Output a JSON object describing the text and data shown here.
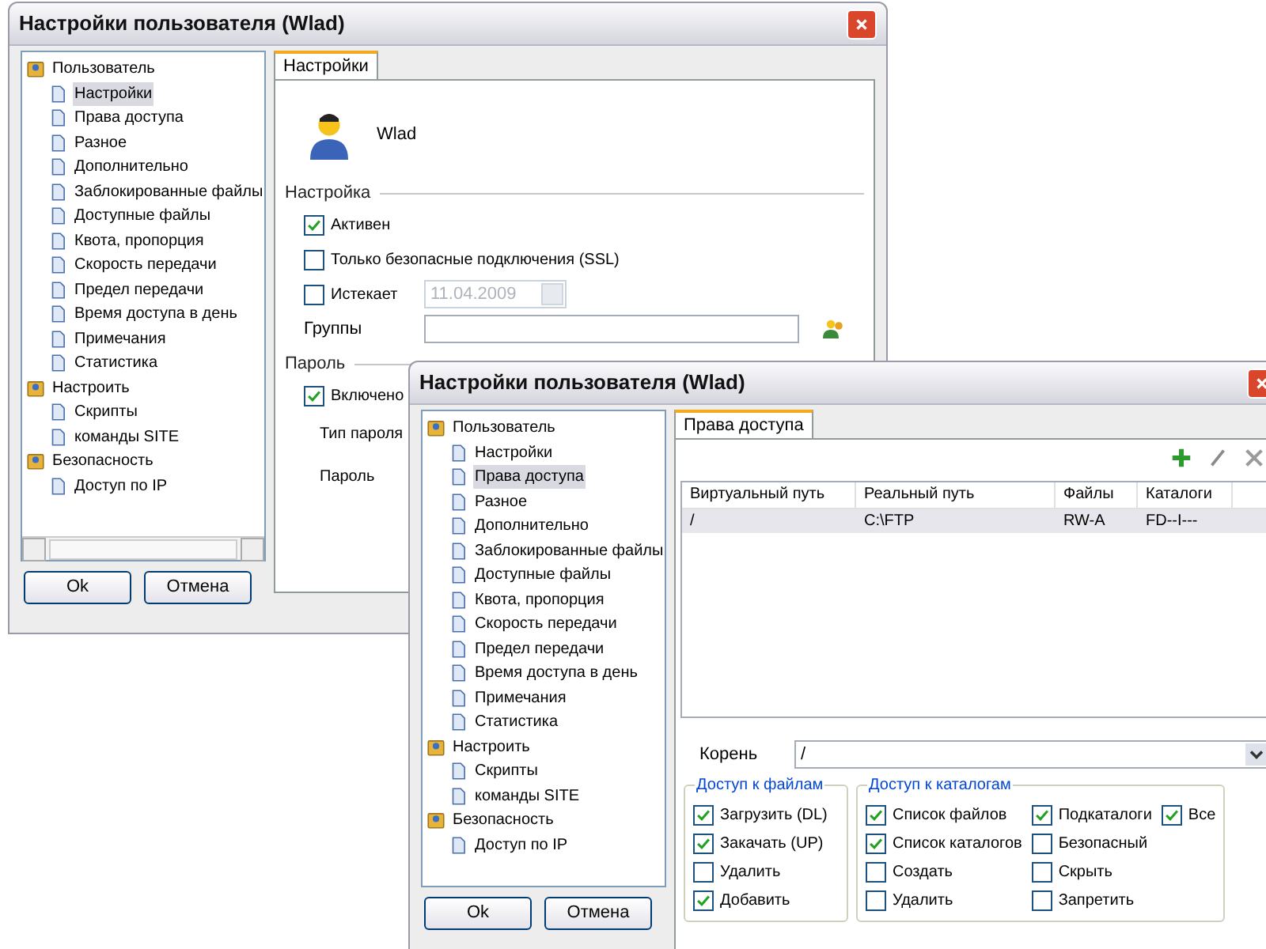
{
  "windows": [
    {
      "kind": "settings",
      "title": "Настройки пользователя (Wlad)",
      "tree": [
        {
          "label": "Пользователь",
          "selected": false,
          "children": [
            {
              "label": "Настройки",
              "selected": true
            },
            {
              "label": "Права доступа",
              "selected": false
            },
            {
              "label": "Разное",
              "selected": false
            },
            {
              "label": "Дополнительно",
              "selected": false
            },
            {
              "label": "Заблокированные файлы",
              "selected": false
            },
            {
              "label": "Доступные файлы",
              "selected": false
            },
            {
              "label": "Квота, пропорция",
              "selected": false
            },
            {
              "label": "Скорость передачи",
              "selected": false
            },
            {
              "label": "Предел передачи",
              "selected": false
            },
            {
              "label": "Время доступа в день",
              "selected": false
            },
            {
              "label": "Примечания",
              "selected": false
            },
            {
              "label": "Статистика",
              "selected": false
            }
          ]
        },
        {
          "label": "Настроить",
          "selected": false,
          "children": [
            {
              "label": "Скрипты",
              "selected": false
            },
            {
              "label": "команды SITE",
              "selected": false
            }
          ]
        },
        {
          "label": "Безопасность",
          "selected": false,
          "children": [
            {
              "label": "Доступ по IP",
              "selected": false
            }
          ]
        }
      ],
      "tabs": [
        {
          "label": "Настройки",
          "selected": true
        }
      ],
      "user_name": "Wlad",
      "sections": [
        {
          "title": "Настройка",
          "rows": [
            {
              "kind": "checkbox",
              "label": "Активен",
              "checked": true
            },
            {
              "kind": "checkbox",
              "label": "Только безопасные подключения (SSL)",
              "checked": false
            },
            {
              "kind": "checkbox_date",
              "label": "Истекает",
              "checked": false,
              "value": "11.04.2009",
              "disabled": true
            },
            {
              "kind": "field",
              "label": "Группы"
            }
          ]
        },
        {
          "title": "Пароль",
          "rows": [
            {
              "kind": "checkbox",
              "label": "Включено",
              "checked": true
            },
            {
              "kind": "label",
              "label": "Тип пароля"
            },
            {
              "kind": "label",
              "label": "Пароль"
            }
          ]
        }
      ],
      "buttons": [
        "Ok",
        "Отмена"
      ]
    },
    {
      "kind": "access",
      "title": "Настройки пользователя (Wlad)",
      "tree": [
        {
          "label": "Пользователь",
          "selected": false,
          "children": [
            {
              "label": "Настройки",
              "selected": false
            },
            {
              "label": "Права доступа",
              "selected": true
            },
            {
              "label": "Разное",
              "selected": false
            },
            {
              "label": "Дополнительно",
              "selected": false
            },
            {
              "label": "Заблокированные файлы",
              "selected": false
            },
            {
              "label": "Доступные файлы",
              "selected": false
            },
            {
              "label": "Квота, пропорция",
              "selected": false
            },
            {
              "label": "Скорость передачи",
              "selected": false
            },
            {
              "label": "Предел передачи",
              "selected": false
            },
            {
              "label": "Время доступа в день",
              "selected": false
            },
            {
              "label": "Примечания",
              "selected": false
            },
            {
              "label": "Статистика",
              "selected": false
            }
          ]
        },
        {
          "label": "Настроить",
          "selected": false,
          "children": [
            {
              "label": "Скрипты",
              "selected": false
            },
            {
              "label": "команды SITE",
              "selected": false
            }
          ]
        },
        {
          "label": "Безопасность",
          "selected": false,
          "children": [
            {
              "label": "Доступ по IP",
              "selected": false
            }
          ]
        }
      ],
      "tabs": [
        {
          "label": "Права доступа",
          "selected": true
        }
      ],
      "table": {
        "columns": [
          "Виртуальный путь",
          "Реальный путь",
          "Файлы",
          "Каталоги"
        ],
        "rows": [
          {
            "cells": [
              "/",
              "C:\\FTP",
              "RW-A",
              "FD--I---"
            ],
            "selected": true
          }
        ]
      },
      "root": {
        "label": "Корень",
        "value": "/"
      },
      "groups": [
        {
          "title": "Доступ к файлам",
          "columns": [
            [
              {
                "label": "Загрузить (DL)",
                "checked": true
              },
              {
                "label": "Закачать (UP)",
                "checked": true
              },
              {
                "label": "Удалить",
                "checked": false
              },
              {
                "label": "Добавить",
                "checked": true
              }
            ]
          ]
        },
        {
          "title": "Доступ к каталогам",
          "columns": [
            [
              {
                "label": "Список файлов",
                "checked": true
              },
              {
                "label": "Список каталогов",
                "checked": true
              },
              {
                "label": "Создать",
                "checked": false
              },
              {
                "label": "Удалить",
                "checked": false
              }
            ],
            [
              {
                "label": "Подкаталоги",
                "checked": true
              },
              {
                "label": "Безопасный",
                "checked": false
              },
              {
                "label": "Скрыть",
                "checked": false
              },
              {
                "label": "Запретить",
                "checked": false
              }
            ],
            [
              {
                "label": "Все",
                "checked": true
              }
            ]
          ]
        }
      ],
      "buttons": [
        "Ok",
        "Отмена"
      ]
    }
  ]
}
